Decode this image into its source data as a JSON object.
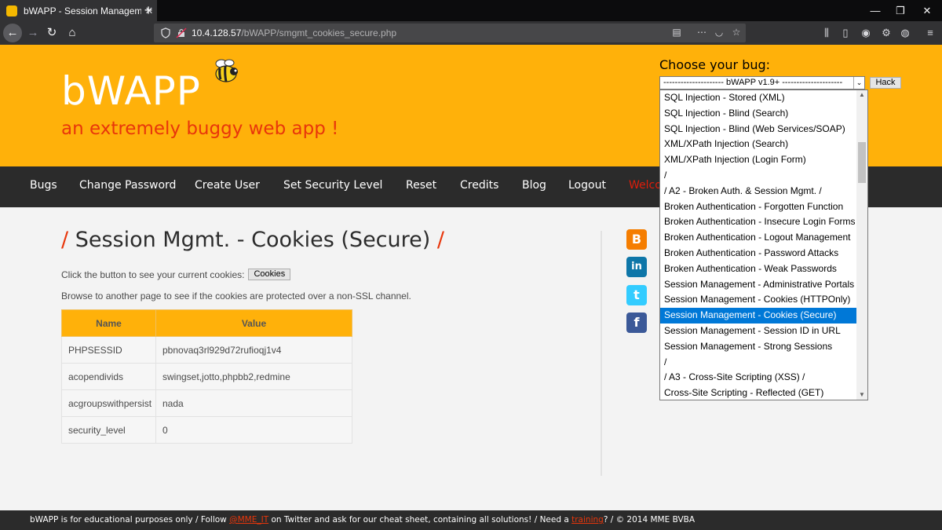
{
  "browser": {
    "tab_title": "bWAPP - Session Management",
    "tab_close": "✕",
    "new_tab": "+",
    "url_host": "10.4.128.57",
    "url_path": "/bWAPP/smgmt_cookies_secure.php",
    "back": "←",
    "forward": "→",
    "reload": "↻",
    "home": "⌂",
    "win_min": "—",
    "win_max": "❐",
    "win_close": "✕"
  },
  "header": {
    "logo": "bWAPP",
    "tagline": "an extremely buggy web app !",
    "choose_label": "Choose your bug:",
    "select_value": "--------------------- bWAPP v1.9+ ---------------------",
    "hack_button": "Hack"
  },
  "menu": {
    "items": [
      "Bugs",
      "Change Password",
      "Create User",
      "Set Security Level",
      "Reset",
      "Credits",
      "Blog",
      "Logout",
      "Welco"
    ]
  },
  "content": {
    "title_slash_left": "/",
    "title": "Session Mgmt. - Cookies (Secure)",
    "title_slash_right": "/",
    "instruction": "Click the button to see your current cookies:",
    "cookies_button": "Cookies",
    "browse_text": "Browse to another page to see if the cookies are protected over a non-SSL channel.",
    "table": {
      "headers": [
        "Name",
        "Value"
      ],
      "rows": [
        [
          "PHPSESSID",
          "pbnovaq3rl929d72rufioqj1v4"
        ],
        [
          "acopendivids",
          "swingset,jotto,phpbb2,redmine"
        ],
        [
          "acgroupswithpersist",
          "nada"
        ],
        [
          "security_level",
          "0"
        ]
      ]
    }
  },
  "social": [
    "B",
    "in",
    "t",
    "f"
  ],
  "dropdown": {
    "options": [
      "SQL Injection - Stored (XML)",
      "SQL Injection - Blind (Search)",
      "SQL Injection - Blind (Web Services/SOAP)",
      "XML/XPath Injection (Search)",
      "XML/XPath Injection (Login Form)",
      "/",
      "/ A2 - Broken Auth. & Session Mgmt. /",
      "Broken Authentication - Forgotten Function",
      "Broken Authentication - Insecure Login Forms",
      "Broken Authentication - Logout Management",
      "Broken Authentication - Password Attacks",
      "Broken Authentication - Weak Passwords",
      "Session Management - Administrative Portals",
      "Session Management - Cookies (HTTPOnly)",
      "Session Management - Cookies (Secure)",
      "Session Management - Session ID in URL",
      "Session Management - Strong Sessions",
      "/",
      "/ A3 - Cross-Site Scripting (XSS) /",
      "Cross-Site Scripting - Reflected (GET)"
    ],
    "selected_index": 14
  },
  "footer": {
    "part1": "bWAPP is for educational purposes only / Follow ",
    "link1": "@MME_IT",
    "part2": " on Twitter and ask for our cheat sheet, containing all solutions! / Need a ",
    "link2": "training",
    "part3": "? / © 2014 MME BVBA"
  }
}
